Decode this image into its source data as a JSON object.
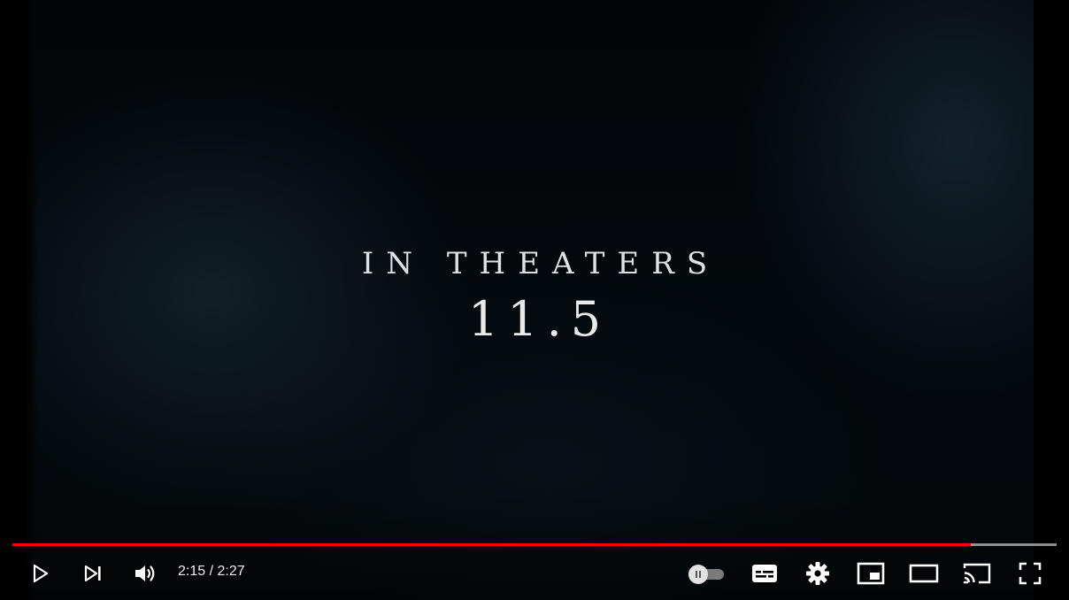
{
  "video": {
    "overlay_line1": "IN THEATERS",
    "overlay_line2": "11.5"
  },
  "player": {
    "time_display": "2:15 / 2:27",
    "progress_played": 0.918,
    "progress_loaded": 1.0,
    "accent_color": "#ff0000",
    "icons": {
      "play": "play-icon",
      "next": "skip-next-icon",
      "volume": "volume-icon",
      "autoplay": "autoplay-toggle",
      "subtitles": "subtitles-icon",
      "settings": "gear-icon",
      "miniplayer": "miniplayer-icon",
      "theater": "theater-mode-icon",
      "cast": "cast-icon",
      "fullscreen": "fullscreen-icon"
    }
  }
}
